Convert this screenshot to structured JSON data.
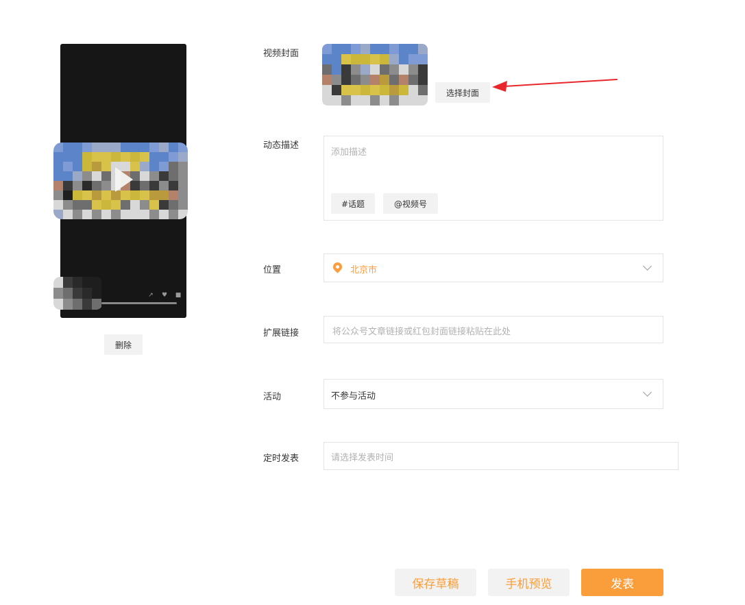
{
  "preview": {
    "delete_label": "删除"
  },
  "form": {
    "cover": {
      "label": "视频封面",
      "select_button": "选择封面"
    },
    "description": {
      "label": "动态描述",
      "placeholder": "添加描述",
      "topic_button": "#话题",
      "channel_button": "@视频号"
    },
    "location": {
      "label": "位置",
      "value": "北京市"
    },
    "link": {
      "label": "扩展链接",
      "placeholder": "将公众号文章链接或红包封面链接粘贴在此处"
    },
    "activity": {
      "label": "活动",
      "value": "不参与活动"
    },
    "schedule": {
      "label": "定时发表",
      "placeholder": "请选择发表时间"
    }
  },
  "footer": {
    "save_draft": "保存草稿",
    "phone_preview": "手机预览",
    "publish": "发表"
  },
  "colors": {
    "accent": "#fa9d3b",
    "arrow": "#e8262b"
  }
}
